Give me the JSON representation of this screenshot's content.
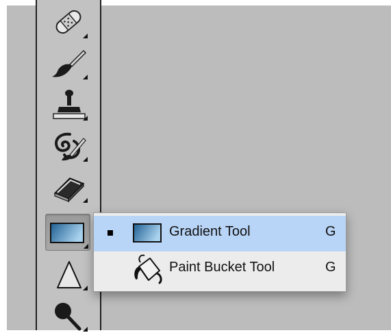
{
  "toolbar": {
    "tools": [
      {
        "icon": "spot-healing-brush-icon",
        "has_flyout": true
      },
      {
        "icon": "brush-icon",
        "has_flyout": true
      },
      {
        "icon": "clone-stamp-icon",
        "has_flyout": true
      },
      {
        "icon": "history-brush-icon",
        "has_flyout": true
      },
      {
        "icon": "eraser-icon",
        "has_flyout": true
      },
      {
        "icon": "gradient-icon",
        "has_flyout": true,
        "active": true
      },
      {
        "icon": "blur-icon",
        "has_flyout": true
      },
      {
        "icon": "dodge-icon",
        "has_flyout": true
      }
    ]
  },
  "flyout": {
    "items": [
      {
        "label": "Gradient Tool",
        "shortcut": "G",
        "icon": "gradient-icon",
        "selected": true
      },
      {
        "label": "Paint Bucket Tool",
        "shortcut": "G",
        "icon": "paint-bucket-icon",
        "selected": false
      }
    ]
  },
  "colors": {
    "canvas_bg": "#bcbcbc",
    "toolbar_bg": "#c2c2c2",
    "menu_bg": "#ececec",
    "menu_highlight": "#b8d4f6",
    "gradient_dark": "#1f5f92",
    "gradient_light": "#a9d2ee"
  }
}
